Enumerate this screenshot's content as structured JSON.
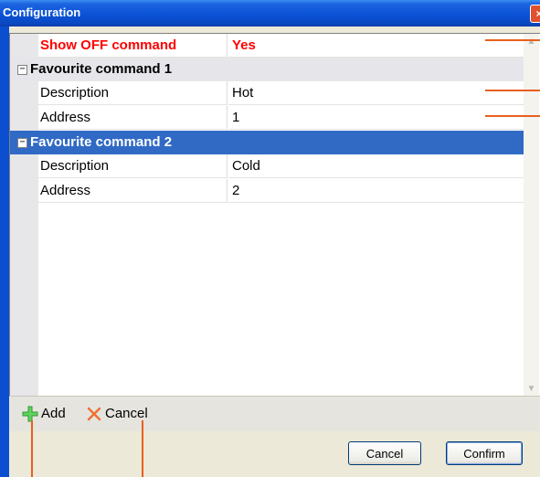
{
  "window": {
    "title": "Configuration",
    "close_label": "×"
  },
  "grid": {
    "top_row": {
      "name": "Show OFF command",
      "value": "Yes"
    },
    "categories": [
      {
        "label": "Favourite command 1",
        "toggle": "−",
        "selected": false,
        "rows": [
          {
            "name": "Description",
            "value": "Hot"
          },
          {
            "name": "Address",
            "value": "1"
          }
        ]
      },
      {
        "label": "Favourite command 2",
        "toggle": "−",
        "selected": true,
        "rows": [
          {
            "name": "Description",
            "value": "Cold"
          },
          {
            "name": "Address",
            "value": "2"
          }
        ]
      }
    ],
    "scroll_up": "▲",
    "scroll_down": "▼"
  },
  "toolbar": {
    "add_label": "Add",
    "cancel_label": "Cancel"
  },
  "buttons": {
    "cancel_label": "Cancel",
    "confirm_label": "Confirm"
  },
  "colors": {
    "highlight": "#ff0000",
    "selection": "#316ac5",
    "callout": "#e8601c",
    "add_icon": "#3cb93c",
    "cancel_icon": "#f07030"
  },
  "icons": {
    "add": "plus-icon",
    "cancel": "x-icon",
    "collapse": "minus-box-icon"
  }
}
